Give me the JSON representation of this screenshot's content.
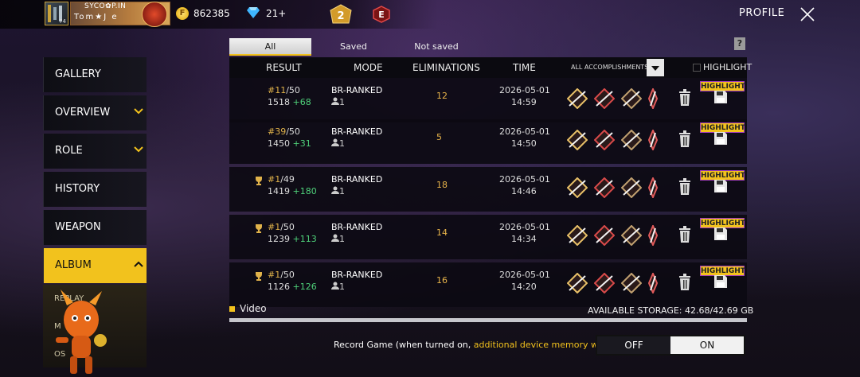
{
  "header": {
    "player_name": "SYCO✿P.IN",
    "player_tag": "Tom★J e",
    "level": "74",
    "coins": "862385",
    "diamonds": "21+",
    "rank_badge": "2",
    "e_badge": "E",
    "profile_label": "PROFILE"
  },
  "sidebar": {
    "items": [
      {
        "label": "GALLERY"
      },
      {
        "label": "OVERVIEW"
      },
      {
        "label": "ROLE"
      },
      {
        "label": "HISTORY"
      },
      {
        "label": "WEAPON"
      },
      {
        "label": "ALBUM"
      }
    ],
    "sub_items": [
      "REPLAY",
      "M",
      "OS"
    ]
  },
  "tabs": [
    {
      "label": "All",
      "active": true
    },
    {
      "label": "Saved",
      "active": false
    },
    {
      "label": "Not saved",
      "active": false
    }
  ],
  "help_label": "?",
  "table": {
    "headers": {
      "result": "RESULT",
      "mode": "MODE",
      "eliminations": "ELIMINATIONS",
      "time": "TIME",
      "filter": "ALL ACCOMPLISHMENTS",
      "highlight": "HIGHLIGHT"
    },
    "rows": [
      {
        "rank_pos": "#11",
        "rank_total": "/50",
        "points": "1518",
        "gain": "+68",
        "mode": "BR-RANKED",
        "players": "1",
        "elims": "12",
        "date": "2026-05-01",
        "time": "14:59",
        "highlight": true,
        "trophy": false
      },
      {
        "rank_pos": "#39",
        "rank_total": "/50",
        "points": "1450",
        "gain": "+31",
        "mode": "BR-RANKED",
        "players": "1",
        "elims": "5",
        "date": "2026-05-01",
        "time": "14:50",
        "highlight": true,
        "trophy": false
      },
      {
        "rank_pos": "#1",
        "rank_total": "/49",
        "points": "1419",
        "gain": "+180",
        "mode": "BR-RANKED",
        "players": "1",
        "elims": "18",
        "date": "2026-05-01",
        "time": "14:46",
        "highlight": true,
        "trophy": true
      },
      {
        "rank_pos": "#1",
        "rank_total": "/50",
        "points": "1239",
        "gain": "+113",
        "mode": "BR-RANKED",
        "players": "1",
        "elims": "14",
        "date": "2026-05-01",
        "time": "14:34",
        "highlight": true,
        "trophy": true
      },
      {
        "rank_pos": "#1",
        "rank_total": "/50",
        "points": "1126",
        "gain": "+126",
        "mode": "BR-RANKED",
        "players": "1",
        "elims": "16",
        "date": "2026-05-01",
        "time": "14:20",
        "highlight": true,
        "trophy": true
      }
    ],
    "highlight_badge": "HIGHLIGHT"
  },
  "footer": {
    "video_label": "Video",
    "storage_label": "AVAILABLE STORAGE:",
    "storage_value": "42.68/42.69 GB",
    "storage_fraction": 0.9998,
    "record_prefix": "Record Game (when turned on, ",
    "record_highlight": "additional device memory will be used.",
    "record_suffix": ")",
    "toggle_off": "OFF",
    "toggle_on": "ON",
    "toggle_state": "OFF"
  },
  "colors": {
    "accent": "#f2c21d",
    "gain": "#4fd27a",
    "elims": "#e8b44a"
  }
}
